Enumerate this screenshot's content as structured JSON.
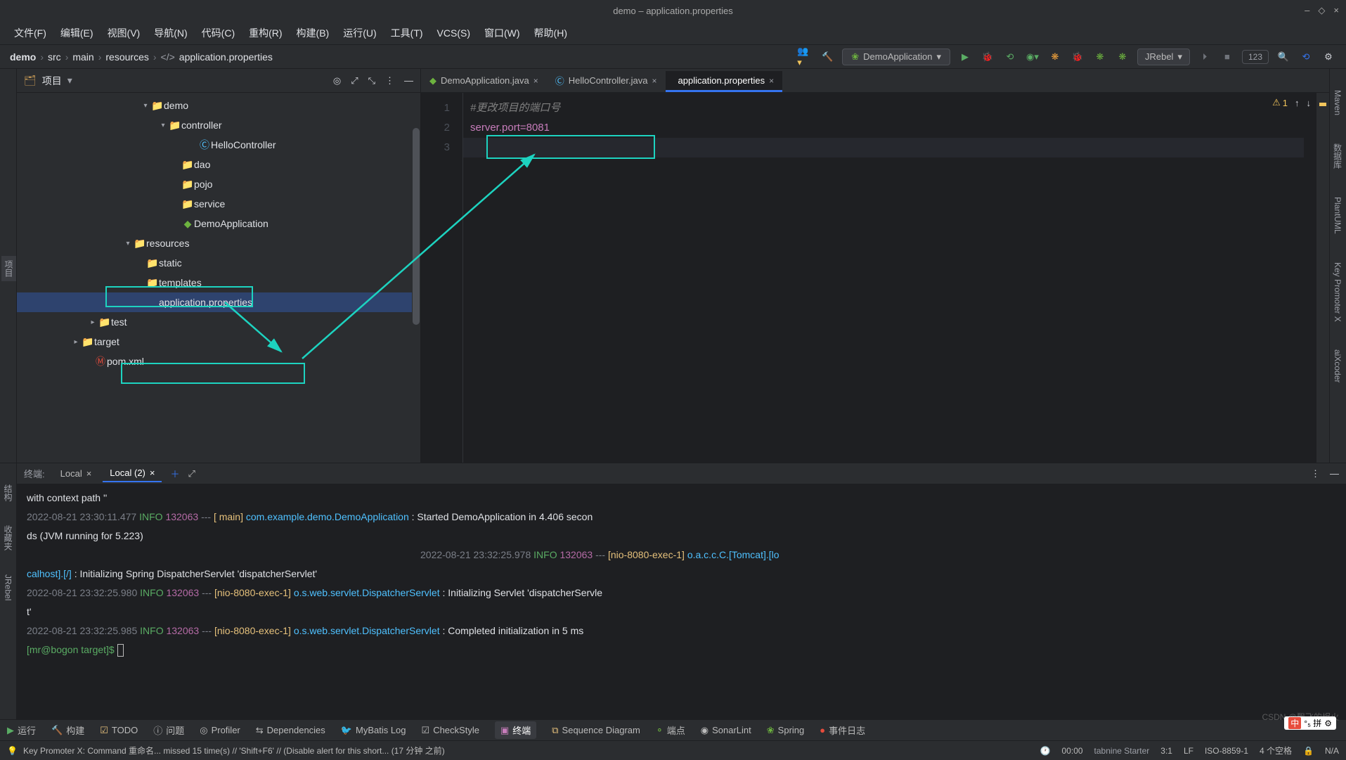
{
  "window": {
    "title": "demo – application.properties"
  },
  "menu": [
    "文件(F)",
    "编辑(E)",
    "视图(V)",
    "导航(N)",
    "代码(C)",
    "重构(R)",
    "构建(B)",
    "运行(U)",
    "工具(T)",
    "VCS(S)",
    "窗口(W)",
    "帮助(H)"
  ],
  "breadcrumb": [
    "demo",
    "src",
    "main",
    "resources",
    "application.properties"
  ],
  "runConfig": {
    "label": "DemoApplication"
  },
  "jrebel": "JRebel",
  "runNumBox": "123",
  "projectPanel": {
    "title": "项目"
  },
  "tree": [
    {
      "indent": 175,
      "arrow": "▾",
      "icon": "📁",
      "iconCls": "folder-ico",
      "label": "demo"
    },
    {
      "indent": 200,
      "arrow": "▾",
      "icon": "📁",
      "iconCls": "folder-ico",
      "label": "controller",
      "tint": "#6db33f"
    },
    {
      "indent": 242,
      "arrow": "",
      "icon": "Ⓒ",
      "iconCls": "",
      "label": "HelloController",
      "ticon": "#4fc1ff"
    },
    {
      "indent": 218,
      "arrow": "",
      "icon": "📁",
      "iconCls": "folder-ico",
      "label": "dao"
    },
    {
      "indent": 218,
      "arrow": "",
      "icon": "📁",
      "iconCls": "folder-ico",
      "label": "pojo"
    },
    {
      "indent": 218,
      "arrow": "",
      "icon": "📁",
      "iconCls": "folder-ico",
      "label": "service",
      "isvc": true
    },
    {
      "indent": 218,
      "arrow": "",
      "icon": "◆",
      "iconCls": "",
      "label": "DemoApplication",
      "ticon": "#6db33f"
    },
    {
      "indent": 150,
      "arrow": "▾",
      "icon": "📁",
      "iconCls": "folder-ico",
      "label": "resources",
      "hl": true,
      "hlId": "hl-resources"
    },
    {
      "indent": 168,
      "arrow": "",
      "icon": "📁",
      "iconCls": "folder-ico",
      "label": "static",
      "blue": true
    },
    {
      "indent": 168,
      "arrow": "",
      "icon": "📁",
      "iconCls": "folder-ico",
      "label": "templates"
    },
    {
      "indent": 168,
      "arrow": "",
      "icon": "</>",
      "iconCls": "",
      "label": "application.properties",
      "sel": true,
      "hl": true,
      "hlId": "hl-appprops",
      "ticon": "#bbbbbb"
    },
    {
      "indent": 100,
      "arrow": "▸",
      "icon": "📁",
      "iconCls": "folder-ico",
      "label": "test",
      "green": true
    },
    {
      "indent": 76,
      "arrow": "▸",
      "icon": "📁",
      "iconCls": "folder-ico",
      "label": "target",
      "red": true
    },
    {
      "indent": 94,
      "arrow": "",
      "icon": "Ⓜ",
      "iconCls": "",
      "label": "pom.xml",
      "ticon": "#e74c3c"
    }
  ],
  "tabs": [
    {
      "icon": "◆",
      "label": "DemoApplication.java",
      "active": false,
      "color": "#6db33f"
    },
    {
      "icon": "Ⓒ",
      "label": "HelloController.java",
      "active": false,
      "color": "#4fc1ff"
    },
    {
      "icon": "</>",
      "label": "application.properties",
      "active": true,
      "color": "#bbbbbb"
    }
  ],
  "editor": {
    "lines": [
      "1",
      "2",
      "3"
    ],
    "comment": "#更改项目的端口号",
    "propLine": "server.port=8081",
    "warnCount": "1"
  },
  "terminal": {
    "label": "终端:",
    "tabs": [
      {
        "name": "Local",
        "active": false
      },
      {
        "name": "Local (2)",
        "active": true
      }
    ],
    "lines": [
      {
        "raw": " with context path ''",
        "white": true
      },
      {
        "ts": "2022-08-21 23:30:11.477",
        "lvl": "INFO",
        "pid": "132063",
        "thr": "[           main]",
        "cls": "com.example.demo.DemoApplication",
        "msg": ": Started DemoApplication in 4.406 secon"
      },
      {
        "raw": "ds (JVM running for 5.223)",
        "white": true
      },
      {
        "ts2": "2022-08-21 23:32:25.978",
        "lvl": "INFO",
        "pid": "132063",
        "thr": "[nio-8080-exec-1]",
        "cls": "o.a.c.c.C.[Tomcat].[lo",
        "rightAlign": true
      },
      {
        "cls2": "calhost].[/]",
        "msg": ": Initializing Spring DispatcherServlet 'dispatcherServlet'"
      },
      {
        "ts": "2022-08-21 23:32:25.980",
        "lvl": "INFO",
        "pid": "132063",
        "thr": "[nio-8080-exec-1]",
        "cls": "o.s.web.servlet.DispatcherServlet",
        "msg": ": Initializing Servlet 'dispatcherServle"
      },
      {
        "raw": "t'",
        "white": true
      },
      {
        "ts": "2022-08-21 23:32:25.985",
        "lvl": "INFO",
        "pid": "132063",
        "thr": "[nio-8080-exec-1]",
        "cls": "o.s.web.servlet.DispatcherServlet",
        "msg": ": Completed initialization in 5 ms"
      },
      {
        "prompt": "[mr@bogon target]$ "
      }
    ]
  },
  "bottomTools": [
    {
      "icon": "▶",
      "label": "运行",
      "color": "#5aac64"
    },
    {
      "icon": "🔨",
      "label": "构建"
    },
    {
      "icon": "☑",
      "label": "TODO",
      "color": "#e5c07b"
    },
    {
      "icon": "ⓘ",
      "label": "问题"
    },
    {
      "icon": "◎",
      "label": "Profiler"
    },
    {
      "icon": "⇆",
      "label": "Dependencies"
    },
    {
      "icon": "🐦",
      "label": "MyBatis Log",
      "color": "#e74c3c"
    },
    {
      "icon": "☑",
      "label": "CheckStyle"
    },
    {
      "icon": "▣",
      "label": "终端",
      "active": true,
      "color": "#c77dbb"
    },
    {
      "icon": "⧉",
      "label": "Sequence Diagram",
      "color": "#e5c07b"
    },
    {
      "icon": "⚬",
      "label": "端点",
      "color": "#6db33f"
    },
    {
      "icon": "◉",
      "label": "SonarLint"
    },
    {
      "icon": "❀",
      "label": "Spring",
      "color": "#6db33f"
    },
    {
      "icon": "●",
      "label": "事件日志",
      "color": "#e74c3c"
    }
  ],
  "status": {
    "left": "Key Promoter X: Command 重命名... missed 15 time(s) // 'Shift+F6' // (Disable alert for this short... (17 分钟 之前)",
    "clock": "00:00",
    "tabnine": "tabnine Starter",
    "pos": "3:1",
    "lf": "LF",
    "enc": "ISO-8859-1",
    "spaces": "4 个空格",
    "na": "N/A"
  },
  "rightTools": [
    "Maven",
    "数据库",
    "PlantUML",
    "Key Promoter X",
    "aiXcoder"
  ],
  "leftBottomTools": [
    "结构",
    "收藏夹",
    "JRebel"
  ],
  "watermark": "CSDN @飘飞的烬火",
  "langBadge": {
    "cn": "中",
    "txt": "°₅ 拼"
  }
}
